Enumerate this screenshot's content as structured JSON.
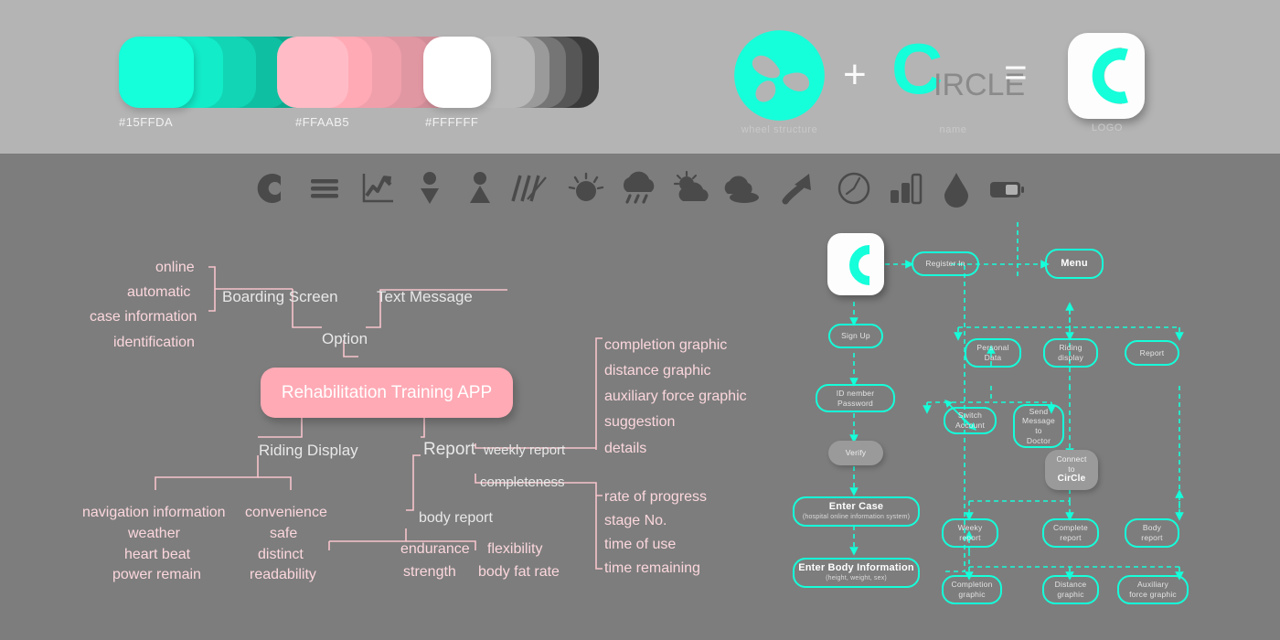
{
  "palette": {
    "teal": "#15FFDA",
    "pink": "#FFAAB5",
    "white": "#FFFFFF",
    "band_light": "#B4B4B4",
    "band_dark": "#7D7D7D"
  },
  "swatches": [
    {
      "name": "teal",
      "label": "#15FFDA",
      "base": "#15FFDA",
      "shades": [
        "#15FFDA",
        "#13ECC9",
        "#11D5B5",
        "#0FBFA2",
        "#0DA98F"
      ]
    },
    {
      "name": "pink",
      "label": "#FFAAB5",
      "base": "#FFAAB5",
      "shades": [
        "#FFBCC6",
        "#FFAAB5",
        "#F0A0AB",
        "#E097A2",
        "#D18E99"
      ]
    },
    {
      "name": "white",
      "label": "#FFFFFF",
      "base": "#FFFFFF",
      "shades": [
        "#FFFFFF",
        "#B8B8B8",
        "#9A9A9A",
        "#757575",
        "#565656",
        "#3A3A3A"
      ]
    }
  ],
  "logo_formula": {
    "wheel_caption": "wheel structure",
    "name_caption": "name",
    "logo_caption": "LOGO",
    "plus": "+",
    "equals": "=",
    "brand_c": "C",
    "brand_rest": "IRCLE"
  },
  "icon_strip": [
    "c-logo-icon",
    "menu-icon",
    "line-chart-icon",
    "female-icon",
    "male-icon",
    "speed-lines-icon",
    "sun-icon",
    "rain-cloud-icon",
    "partly-cloudy-icon",
    "cloudy-icon",
    "arrow-up-curve-icon",
    "clock-icon",
    "bar-chart-icon",
    "water-drop-icon",
    "battery-icon"
  ],
  "mindmap": {
    "center": "Rehabilitation Training APP",
    "option": "Option",
    "boarding_screen": "Boarding Screen",
    "text_message": "Text Message",
    "boarding_leaves": [
      "online",
      "automatic",
      "case information",
      "identification"
    ],
    "riding_display": "Riding Display",
    "riding_left": [
      "navigation information",
      "weather",
      "heart beat",
      "power remain"
    ],
    "riding_right": [
      "convenience",
      "safe",
      "distinct",
      "readability"
    ],
    "report": "Report",
    "weekly_report": "weekly report",
    "completeness": "completeness",
    "body_report": "body report",
    "weekly_leaves": [
      "completion graphic",
      "distance graphic",
      "auxiliary force graphic",
      "suggestion",
      "details"
    ],
    "completeness_leaves": [
      "rate of progress",
      "stage No.",
      "time of use",
      "time remaining"
    ],
    "body_left": [
      "endurance",
      "strength"
    ],
    "body_right": [
      "flexibility",
      "body fat rate"
    ]
  },
  "flowchart": {
    "app_icon": "circle-app-icon",
    "nodes": {
      "register_in": "Register In",
      "menu": "Menu",
      "sign_up": "Sign Up",
      "id_password_l1": "ID nember",
      "id_password_l2": "Password",
      "verify": "Verify",
      "enter_case": "Enter Case",
      "enter_case_sub": "(hospital online information system)",
      "enter_body": "Enter Body Information",
      "enter_body_sub": "(height,  weight,  sex)",
      "personal_data_l1": "Personal",
      "personal_data_l2": "Data",
      "riding_display_l1": "Riding",
      "riding_display_l2": "display",
      "report": "Report",
      "switch_account_l1": "Switch",
      "switch_account_l2": "Account",
      "send_message_l1": "Send",
      "send_message_l2": "Message",
      "send_message_l3": "to",
      "send_message_l4": "Doctor",
      "connect_l1": "Connect",
      "connect_l2": "to",
      "connect_brand": "CirCle",
      "weekly_report_l1": "Weeky",
      "weekly_report_l2": "report",
      "complete_report_l1": "Complete",
      "complete_report_l2": "report",
      "body_report_l1": "Body",
      "body_report_l2": "report",
      "completion_graphic_l1": "Completion",
      "completion_graphic_l2": "graphic",
      "distance_graphic_l1": "Distance",
      "distance_graphic_l2": "graphic",
      "auxiliary_graphic_l1": "Auxiliary",
      "auxiliary_graphic_l2": "force graphic"
    }
  }
}
